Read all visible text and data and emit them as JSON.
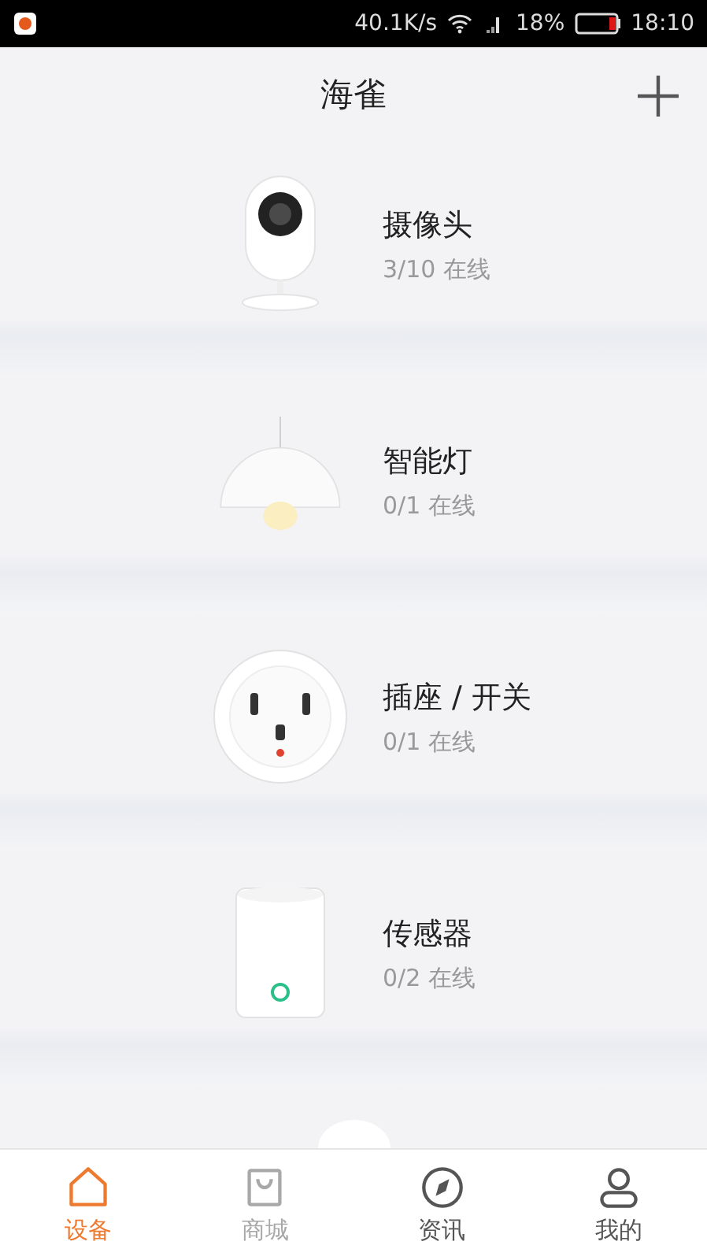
{
  "status_bar": {
    "speed": "40.1K/s",
    "battery_text": "18%",
    "time": "18:10"
  },
  "header": {
    "title": "海雀"
  },
  "devices": [
    {
      "kind": "camera",
      "name": "摄像头",
      "status": "3/10 在线"
    },
    {
      "kind": "lamp",
      "name": "智能灯",
      "status": "0/1 在线"
    },
    {
      "kind": "socket",
      "name": "插座 / 开关",
      "status": "0/1 在线"
    },
    {
      "kind": "sensor",
      "name": "传感器",
      "status": "0/2 在线"
    }
  ],
  "tabs": [
    {
      "kind": "home",
      "label": "设备",
      "selected": true,
      "disabled": false
    },
    {
      "kind": "bag",
      "label": "商城",
      "selected": false,
      "disabled": true
    },
    {
      "kind": "compass",
      "label": "资讯",
      "selected": false,
      "disabled": false
    },
    {
      "kind": "person",
      "label": "我的",
      "selected": false,
      "disabled": false
    }
  ]
}
